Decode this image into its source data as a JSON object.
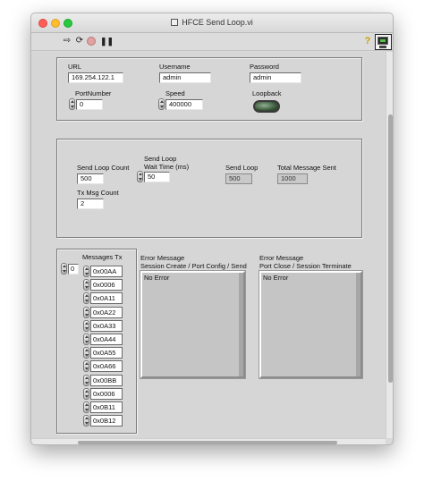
{
  "window": {
    "title": "HFCE Send Loop.vi"
  },
  "toolbar": {
    "run_icon": "run-arrow-icon",
    "run_continuous_icon": "run-continuously-icon",
    "abort_icon": "abort-icon",
    "pause_icon": "pause-icon",
    "help_icon": "help-icon",
    "help_glyph": "?",
    "run_glyph": "⇨",
    "runc_glyph": "⟳",
    "pause_glyph": "❚❚"
  },
  "connection": {
    "url_label": "URL",
    "url_value": "169.254.122.1",
    "username_label": "Username",
    "username_value": "admin",
    "password_label": "Password",
    "password_value": "admin",
    "port_label": "PortNumber",
    "port_value": "0",
    "speed_label": "Speed",
    "speed_value": "400000",
    "loopback_label": "Loopback"
  },
  "loop": {
    "send_count_label": "Send Loop Count",
    "send_count_value": "500",
    "wait_label_1": "Send Loop",
    "wait_label_2": "Wait Time (ms)",
    "wait_value": "50",
    "send_loop_label": "Send Loop",
    "send_loop_value": "500",
    "total_label": "Total Message Sent",
    "total_value": "1000",
    "tx_count_label": "Tx Msg Count",
    "tx_count_value": "2"
  },
  "messages": {
    "label": "Messages Tx",
    "index_value": "0",
    "items": [
      "0x00AA",
      "0x0006",
      "0x0A11",
      "0x0A22",
      "0x0A33",
      "0x0A44",
      "0x0A55",
      "0x0A66",
      "0x00BB",
      "0x0006",
      "0x0B11",
      "0x0B12"
    ]
  },
  "errors": {
    "left_label_1": "Error Message",
    "left_label_2": "Session Create / Port Config / Send",
    "left_value": "No Error",
    "right_label_1": "Error Message",
    "right_label_2": "Port Close / Session Terminate",
    "right_value": "No Error"
  }
}
